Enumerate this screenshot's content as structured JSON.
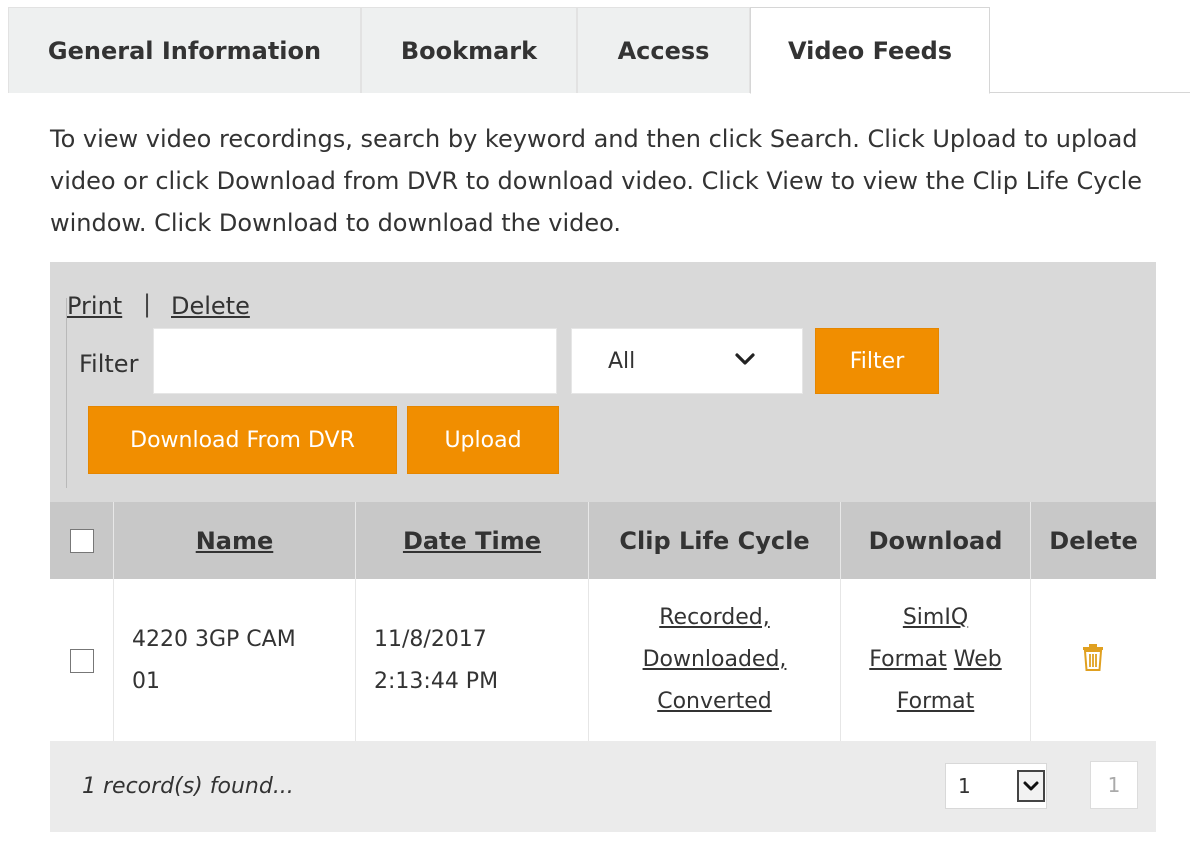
{
  "tabs": [
    {
      "label": "General Information"
    },
    {
      "label": "Bookmark"
    },
    {
      "label": "Access"
    },
    {
      "label": "Video Feeds",
      "active": true
    }
  ],
  "intro_text": "To view video recordings, search by keyword and then click Search. Click Upload to upload video or click Download from DVR to download video. Click View to view the Clip Life Cycle window. Click Download to download the video.",
  "toolbar": {
    "print_label": "Print",
    "separator": "|",
    "delete_label": "Delete",
    "filter_label": "Filter",
    "filter_value": "",
    "select_value": "All",
    "filter_button": "Filter",
    "download_dvr_button": "Download From DVR",
    "upload_button": "Upload"
  },
  "table": {
    "columns": {
      "name": "Name",
      "date_time": "Date Time",
      "clip_life_cycle": "Clip Life Cycle",
      "download": "Download",
      "delete": "Delete"
    },
    "rows": [
      {
        "name_line1": "4220 3GP CAM",
        "name_line2": "01",
        "date": "11/8/2017",
        "time": "2:13:44 PM",
        "life_recorded": "Recorded,",
        "life_downloaded": "Downloaded,",
        "life_converted": "Converted",
        "dl_simiq_1": "SimIQ",
        "dl_simiq_2": "Format",
        "dl_web_1": "Web",
        "dl_web_2": "Format"
      }
    ]
  },
  "footer": {
    "records_found": "1 record(s) found...",
    "page_select_value": "1",
    "page_number": "1"
  },
  "colors": {
    "accent": "#f18e00",
    "trash": "#e0a020",
    "toolbar_bg": "#d9d9d9",
    "header_bg": "#c8c8c8"
  }
}
